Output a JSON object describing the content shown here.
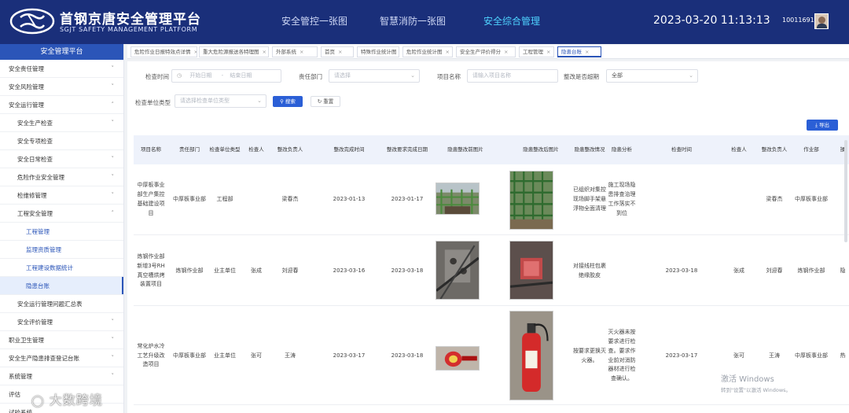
{
  "header": {
    "title": "首钢京唐安全管理平台",
    "subtitle": "SGJT SAFETY MANAGEMENT PLATFORM",
    "nav": [
      "安全管控一张图",
      "智慧消防一张图",
      "安全综合管理"
    ],
    "active_nav": "安全综合管理",
    "datetime": "2023-03-20 11:13:13",
    "user_id": "10011691"
  },
  "sidebar": {
    "title": "安全管理平台",
    "items": [
      {
        "label": "安全责任管理",
        "level": 1,
        "state": "collapsed"
      },
      {
        "label": "安全风险管理",
        "level": 1,
        "state": "collapsed"
      },
      {
        "label": "安全运行管理",
        "level": 1,
        "state": "expanded"
      },
      {
        "label": "安全生产检查",
        "level": 2,
        "state": "collapsed"
      },
      {
        "label": "安全专项检查",
        "level": 2,
        "state": "none"
      },
      {
        "label": "安全日常检查",
        "level": 2,
        "state": "collapsed"
      },
      {
        "label": "危险作业安全管理",
        "level": 2,
        "state": "collapsed"
      },
      {
        "label": "检维修管理",
        "level": 2,
        "state": "collapsed"
      },
      {
        "label": "工程安全管理",
        "level": 2,
        "state": "expanded"
      },
      {
        "label": "工程管理",
        "level": 3,
        "state": "none"
      },
      {
        "label": "监理资质管理",
        "level": 3,
        "state": "none"
      },
      {
        "label": "工程建设数据统计",
        "level": 3,
        "state": "none"
      },
      {
        "label": "隐患台账",
        "level": 3,
        "state": "active"
      },
      {
        "label": "安全运行管理问题汇总表",
        "level": 2,
        "state": "none"
      },
      {
        "label": "安全评价管理",
        "level": 2,
        "state": "collapsed"
      },
      {
        "label": "职业卫生管理",
        "level": 1,
        "state": "collapsed"
      },
      {
        "label": "安全生产隐患排查登记台账",
        "level": 1,
        "state": "collapsed"
      },
      {
        "label": "系统管理",
        "level": 1,
        "state": "collapsed"
      },
      {
        "label": "评估",
        "level": 1,
        "state": "none"
      },
      {
        "label": "试验系统",
        "level": 1,
        "state": "none"
      }
    ]
  },
  "tabs": [
    {
      "label": "危险作业日报特效点详情",
      "active": false
    },
    {
      "label": "重大危险源报送各特理图",
      "active": false
    },
    {
      "label": "外部系统",
      "active": false
    },
    {
      "label": "首页",
      "active": false
    },
    {
      "label": "特殊作业统计图",
      "active": false
    },
    {
      "label": "危险作业统计图",
      "active": false
    },
    {
      "label": "安全生产评价得分",
      "active": false
    },
    {
      "label": "工程管理",
      "active": false
    },
    {
      "label": "隐患台账",
      "active": true
    }
  ],
  "filters": {
    "check_time_label": "检查时间",
    "start_placeholder": "开始日期",
    "range_sep": "-",
    "end_placeholder": "结束日期",
    "dept_label": "责任部门",
    "dept_placeholder": "请选择",
    "project_label": "项目名称",
    "project_placeholder": "请输入项目名称",
    "overdue_label": "整改是否超期",
    "overdue_value": "全部",
    "unit_type_label": "检查单位类型",
    "unit_type_placeholder": "请选择检查单位类型",
    "search_label": "搜索",
    "reset_label": "重置",
    "export_label": "导出"
  },
  "table": {
    "columns": [
      "项目名称",
      "责任部门",
      "检查单位类型",
      "检查人",
      "整改负责人",
      "整改完成时间",
      "整改要求完成日期",
      "隐患整改前图片",
      "隐患整改后图片",
      "隐患整改情况",
      "隐患分析",
      "检查时间",
      "检查人",
      "整改负责人",
      "作业部",
      "操"
    ],
    "rows": [
      {
        "project": "中厚板事业部生产集控基础建设项目",
        "dept": "中厚板事业部",
        "unit_type": "工程部",
        "inspector": "",
        "owner": "梁春杰",
        "done_time": "2023-01-13",
        "req_date": "2023-01-17",
        "status": "已组织对集控现场脚手架悬浮物全面清理",
        "analysis": "施工现场隐患排查治理工作落实不到位",
        "check_time": "",
        "inspector2": "",
        "owner2": "梁春杰",
        "work_dept": "中厚板事业部",
        "op": ""
      },
      {
        "project": "炼钢作业部新增3号RH真空槽烘烤装置项目",
        "dept": "炼钢作业部",
        "unit_type": "业主单位",
        "inspector": "张成",
        "owner": "刘迎春",
        "done_time": "2023-03-16",
        "req_date": "2023-03-18",
        "status": "对接线柱包裹绝缘胶皮",
        "analysis": "",
        "check_time": "2023-03-18",
        "inspector2": "张成",
        "owner2": "刘迎春",
        "work_dept": "炼钢作业部",
        "op": "隐"
      },
      {
        "project": "常化炉水冷工艺升级改造项目",
        "dept": "中厚板事业部",
        "unit_type": "业主单位",
        "inspector": "张可",
        "owner": "王涛",
        "done_time": "2023-03-17",
        "req_date": "2023-03-18",
        "status": "按要求更换灭火器。",
        "analysis": "灭火器未按要求进行检查。要求作业前对消防器材进行检查确认。",
        "check_time": "2023-03-17",
        "inspector2": "张可",
        "owner2": "王涛",
        "work_dept": "中厚板事业部",
        "op": "热"
      }
    ]
  },
  "watermarks": {
    "activate_title": "激活 Windows",
    "activate_hint": "转到\"设置\"以激活 Windows。",
    "brand": "大数跨境"
  },
  "colors": {
    "header_bg": "#1a2f7a",
    "accent": "#2b55b8",
    "active_nav": "#4fd3ff",
    "primary_button": "#2b5fd6"
  }
}
